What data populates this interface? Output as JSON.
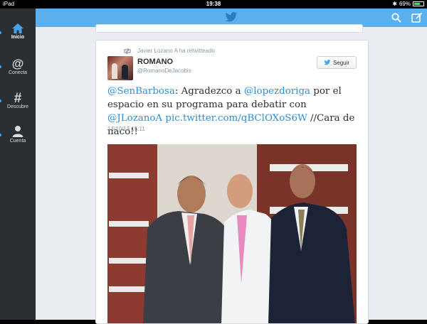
{
  "status_bar": {
    "device": "iPad",
    "time": "19:38",
    "battery": "69%",
    "battery_level": 0.69
  },
  "sidebar": {
    "items": [
      {
        "label": "Inicio",
        "icon": "home-icon",
        "active": true
      },
      {
        "label": "Conecta",
        "icon": "at-icon"
      },
      {
        "label": "Descubre",
        "icon": "hash-icon"
      },
      {
        "label": "Cuenta",
        "icon": "person-icon"
      }
    ]
  },
  "topbar": {
    "logo": "twitter-bird-icon",
    "search_icon": "search-icon",
    "compose_icon": "compose-icon"
  },
  "tweet": {
    "retweet_line": "Javier Lozano A ha retwitteado",
    "author_name": "ROMANO",
    "author_handle": "@RomanoDeJacobis",
    "follow_label": "Seguir",
    "mention1": "@SenBarbosa",
    "text1": ": Agradezco a ",
    "mention2": "@lopezdoriga",
    "text2": " por el espacio en su programa para debatir con ",
    "mention3": "@JLozanoA",
    "link": "pic.twitter.com/qBClOXoS6W",
    "text3": " //Cara de naco!!",
    "timestamp": "14/10/13 15:11"
  },
  "colors": {
    "accent": "#5ab0ec",
    "link": "#2a8ed8",
    "sidebar": "#2a2f33"
  }
}
